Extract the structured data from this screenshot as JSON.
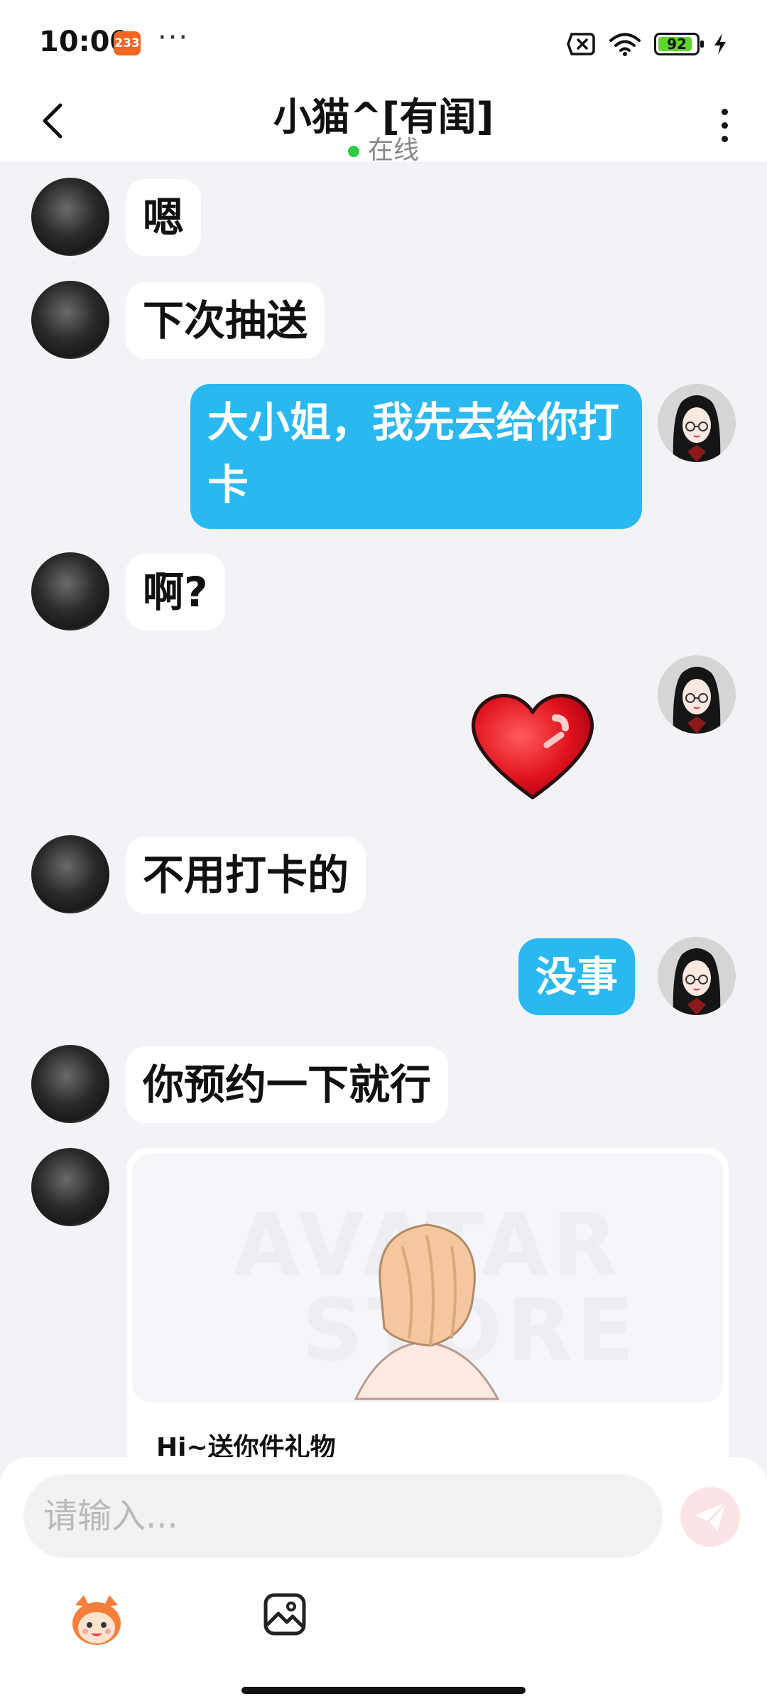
{
  "status_bar": {
    "time": "10:00",
    "notification_badge": "233",
    "more_dots": "···",
    "battery_level": "92",
    "battery_fraction": 0.92,
    "icons": [
      "sim-off-icon",
      "wifi-icon",
      "battery-icon",
      "charging-icon"
    ]
  },
  "header": {
    "title": "小猫^[有闺]",
    "status": "在线",
    "back_icon": "back-arrow-icon",
    "more_icon": "more-vertical-icon",
    "online_color": "#2ecc40"
  },
  "messages": [
    {
      "sender": "other",
      "text": "嗯"
    },
    {
      "sender": "other",
      "text": "下次抽送"
    },
    {
      "sender": "self",
      "text": "大小姐，我先去给你打卡"
    },
    {
      "sender": "other",
      "text": "啊?"
    },
    {
      "sender": "self",
      "type": "sticker",
      "sticker": "red-heart-sticker"
    },
    {
      "sender": "other",
      "text": "不用打卡的"
    },
    {
      "sender": "self",
      "text": "没事"
    },
    {
      "sender": "other",
      "text": "你预约一下就行"
    },
    {
      "sender": "other",
      "type": "gift_card",
      "watermark_lines": [
        "AVATAR",
        "STORE"
      ],
      "title": "Hi~送你件礼物"
    }
  ],
  "input": {
    "placeholder": "请输入..."
  },
  "toolbar": {
    "icons": [
      "emoji-mascot-icon",
      "image-icon",
      "send-icon"
    ]
  },
  "colors": {
    "self_bubble": "#2ab8f0",
    "other_bubble": "#ffffff",
    "background": "#f2f3f7",
    "send_button": "#fce3e6",
    "badge": "#f26522"
  }
}
